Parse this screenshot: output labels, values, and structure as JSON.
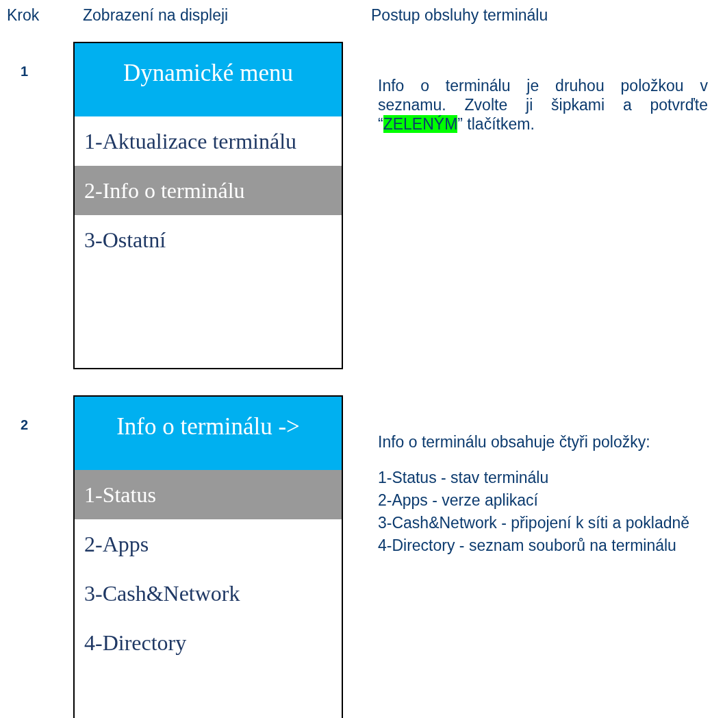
{
  "columns": [
    "Krok",
    "Zobrazení na displeji",
    "Postup obsluhy terminálu"
  ],
  "steps": [
    {
      "number": "1",
      "display": {
        "title": "Dynamické menu",
        "items": [
          {
            "label": "1-Aktualizace terminálu",
            "selected": false
          },
          {
            "label": "2-Info o terminálu",
            "selected": true
          },
          {
            "label": "3-Ostatní",
            "selected": false
          }
        ]
      },
      "instructions": {
        "paragraph": [
          {
            "text": "Info o terminálu je druhou položkou v seznamu. Zvolte ji šipkami a potvrďte “",
            "highlight": false
          },
          {
            "text": "ZELENÝM",
            "highlight": true
          },
          {
            "text": "” tlačítkem.",
            "highlight": false
          }
        ]
      }
    },
    {
      "number": "2",
      "display": {
        "title": "Info o terminálu ->",
        "items": [
          {
            "label": "1-Status",
            "selected": true
          },
          {
            "label": "2-Apps",
            "selected": false
          },
          {
            "label": "3-Cash&Network",
            "selected": false
          },
          {
            "label": "4-Directory",
            "selected": false
          }
        ]
      },
      "instructions": {
        "intro": "Info o terminálu obsahuje čtyři položky:",
        "lines": [
          "1-Status - stav terminálu",
          "2-Apps - verze aplikací",
          "3-Cash&Network - připojení k síti a pokladně",
          "4-Directory - seznam souborů na terminálu"
        ]
      }
    }
  ]
}
